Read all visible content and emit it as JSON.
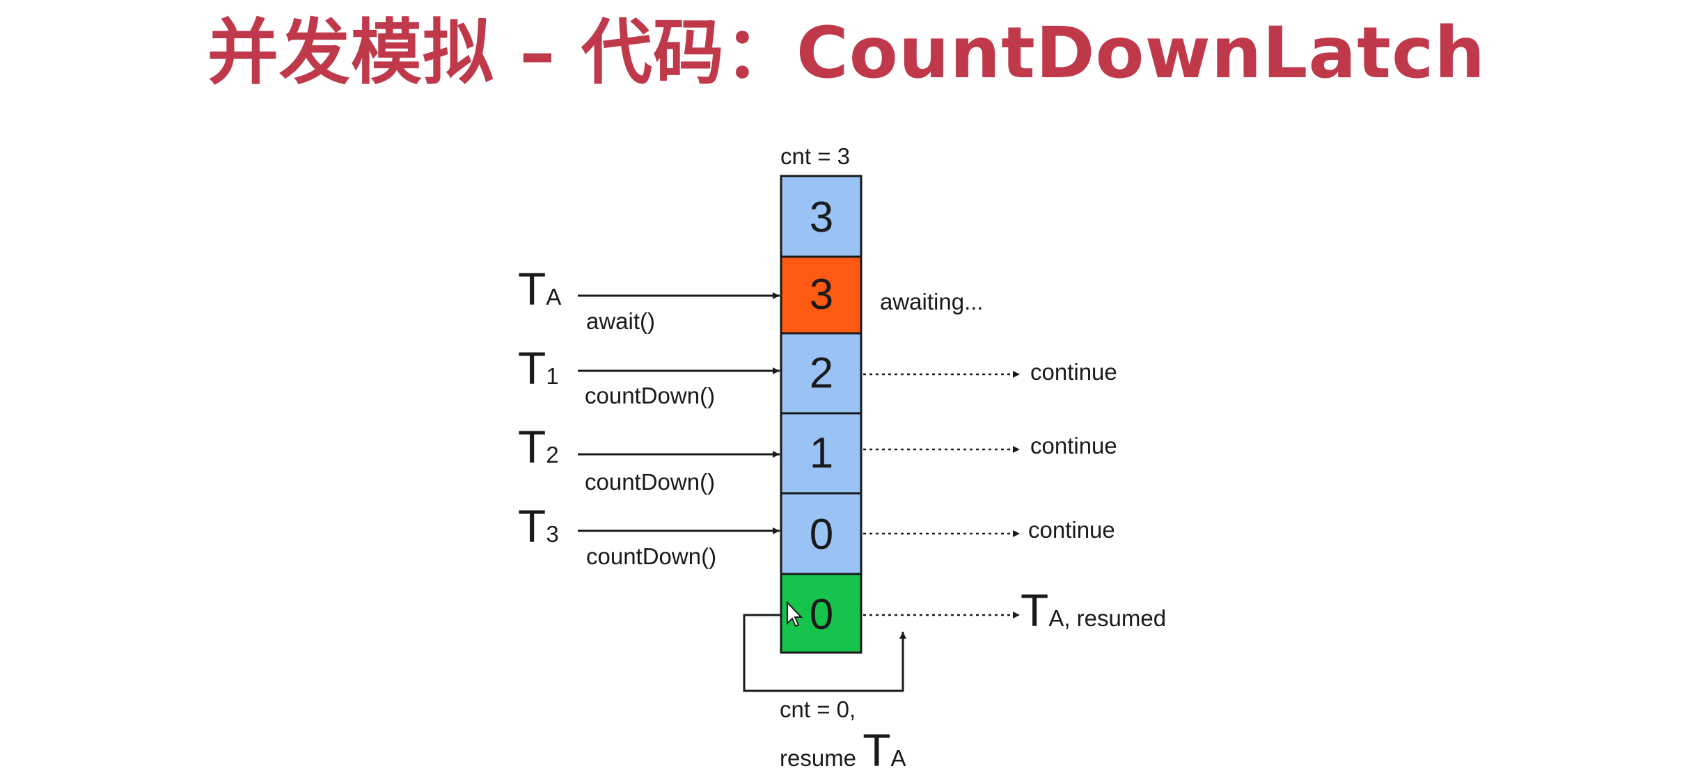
{
  "title": "并发模拟 – 代码：CountDownLatch",
  "colors": {
    "title": "#c0394b",
    "cell_blue": "#99c2f5",
    "cell_orange": "#ff5a14",
    "cell_green": "#16c34c",
    "stroke": "#1a1a1a"
  },
  "diagram": {
    "top_label": "cnt = 3",
    "cells": [
      {
        "value": "3",
        "state": "initial"
      },
      {
        "value": "3",
        "state": "awaiting"
      },
      {
        "value": "2",
        "state": "counting"
      },
      {
        "value": "1",
        "state": "counting"
      },
      {
        "value": "0",
        "state": "counting"
      },
      {
        "value": "0",
        "state": "released"
      }
    ],
    "threads": [
      {
        "main": "T",
        "sub": "A",
        "call": "await()"
      },
      {
        "main": "T",
        "sub": "1",
        "call": "countDown()"
      },
      {
        "main": "T",
        "sub": "2",
        "call": "countDown()"
      },
      {
        "main": "T",
        "sub": "3",
        "call": "countDown()"
      }
    ],
    "awaiting_label": "awaiting...",
    "continue_labels": [
      "continue",
      "continue",
      "continue"
    ],
    "resumed": {
      "main": "T",
      "sub": "A, resumed"
    },
    "bottom_label_line1": "cnt = 0,",
    "bottom_label_line2_prefix": "resume ",
    "bottom_label_line2_main": "T",
    "bottom_label_line2_sub": "A",
    "cursor_icon": "mouse-pointer-icon"
  }
}
